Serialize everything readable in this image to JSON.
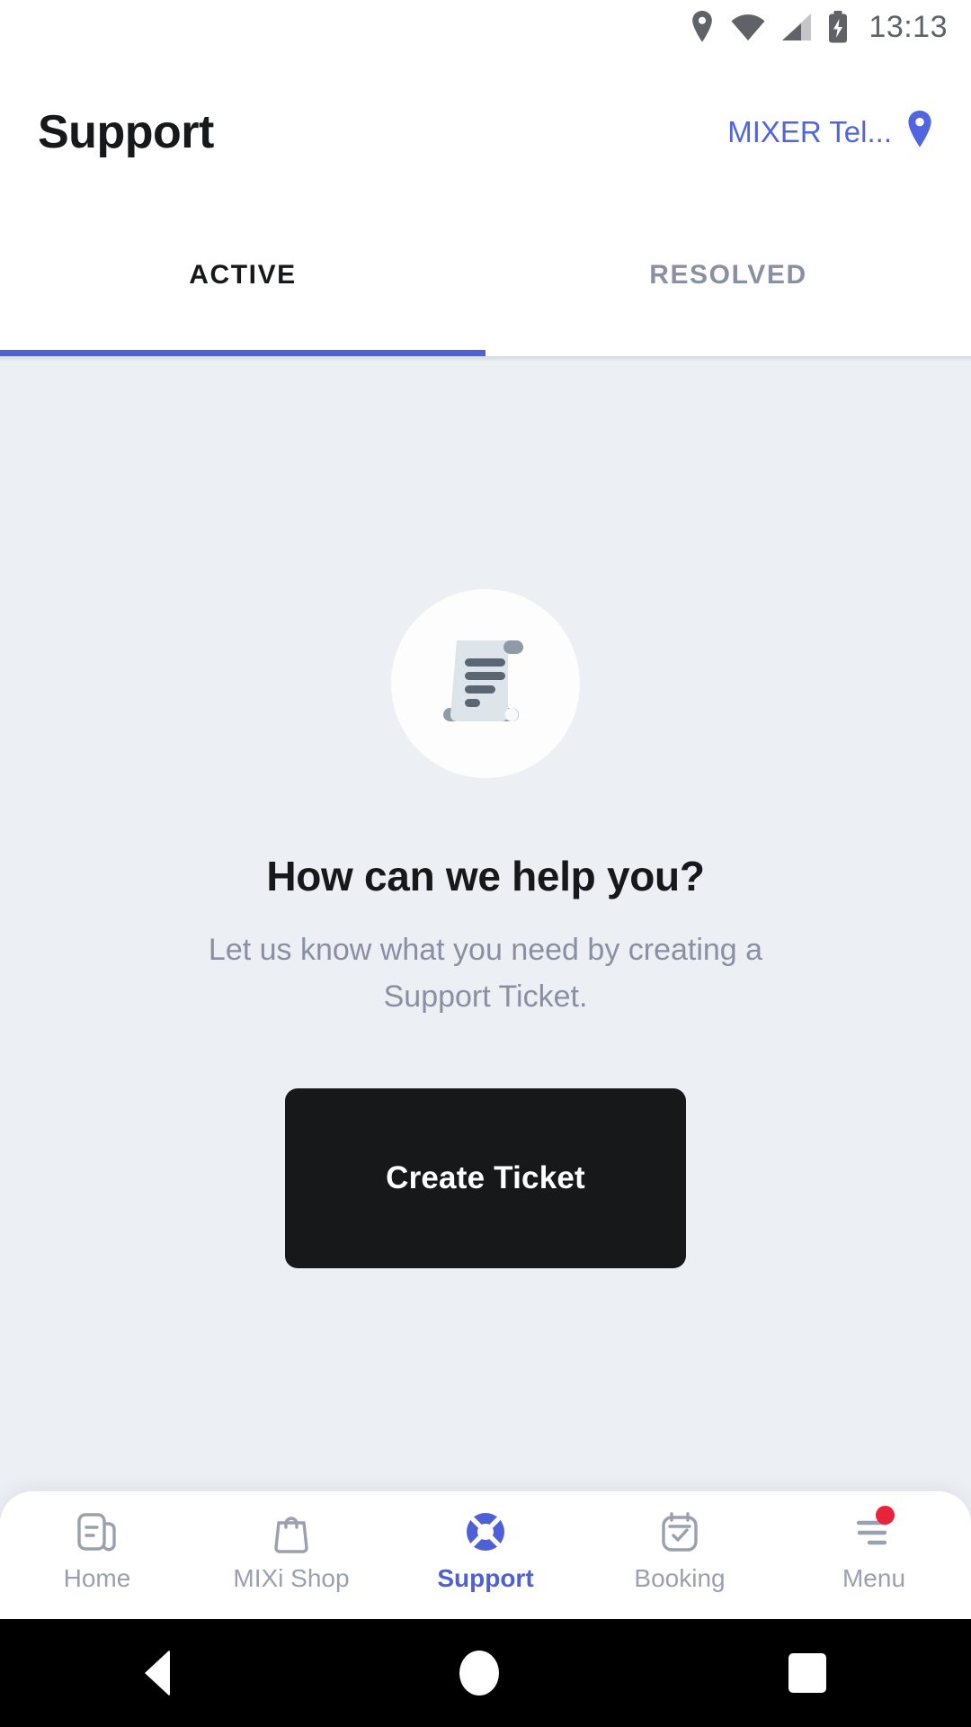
{
  "status_bar": {
    "time": "13:13",
    "icons": [
      "location-pin-icon",
      "wifi-icon",
      "signal-icon",
      "battery-charging-icon"
    ]
  },
  "header": {
    "title": "Support",
    "location_label": "MIXER Tel...",
    "location_icon": "location-pin-icon",
    "accent_color": "#5265e0"
  },
  "tabs": {
    "items": [
      {
        "label": "ACTIVE",
        "active": true
      },
      {
        "label": "RESOLVED",
        "active": false
      }
    ],
    "indicator_color": "#4f5fd6"
  },
  "empty_state": {
    "illustration_icon": "document-scroll-icon",
    "headline": "How can we help you?",
    "subtitle": "Let us know what you need by creating a Support Ticket.",
    "cta_label": "Create Ticket",
    "cta_bg_color": "#16181a",
    "background_color": "#eceff4"
  },
  "bottom_nav": {
    "items": [
      {
        "label": "Home",
        "icon": "document-home-icon",
        "active": false,
        "badge": false
      },
      {
        "label": "MIXi Shop",
        "icon": "shopping-bag-icon",
        "active": false,
        "badge": false
      },
      {
        "label": "Support",
        "icon": "lifebuoy-icon",
        "active": true,
        "badge": false
      },
      {
        "label": "Booking",
        "icon": "calendar-check-icon",
        "active": false,
        "badge": false
      },
      {
        "label": "Menu",
        "icon": "hamburger-menu-icon",
        "active": false,
        "badge": true
      }
    ],
    "active_color": "#4f5fd6",
    "inactive_color": "#9aa0af",
    "badge_color": "#e8243a"
  },
  "system_nav": {
    "back": "back-button",
    "home": "home-button",
    "recents": "recents-button"
  }
}
